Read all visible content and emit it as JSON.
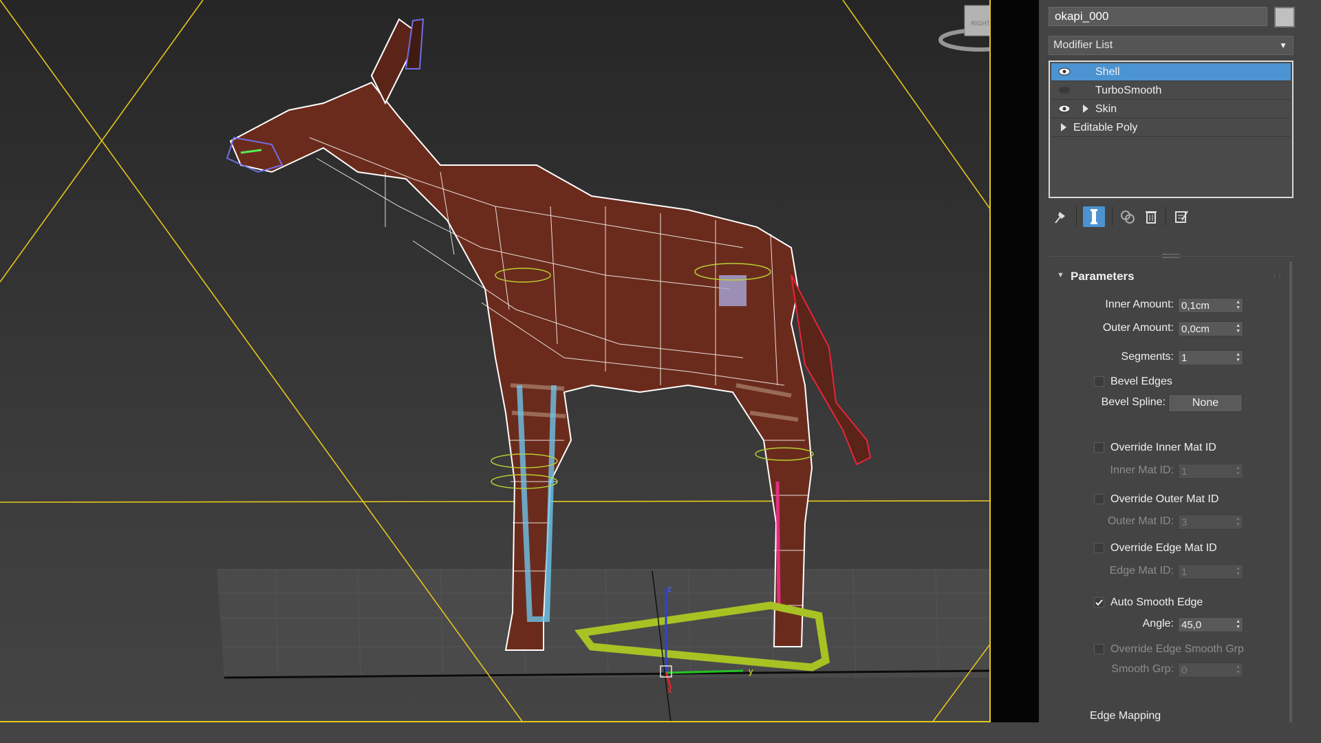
{
  "object_name": "okapi_000",
  "object_color": "#c0c0c0",
  "modifier_list_label": "Modifier List",
  "stack": [
    {
      "label": "Shell",
      "selected": true,
      "eye": "eye-icon"
    },
    {
      "label": "TurboSmooth",
      "selected": false,
      "eye": "eye-off-icon"
    },
    {
      "label": "Skin",
      "selected": false,
      "eye": "eye-icon"
    },
    {
      "label": "Editable Poly",
      "selected": false,
      "eye": ""
    }
  ],
  "toolbar_icons": [
    "pin-stack-icon",
    "show-end-result-icon",
    "make-unique-icon",
    "remove-modifier-icon",
    "configure-modifier-sets-icon"
  ],
  "rollout_title": "Parameters",
  "params": {
    "inner_amount_label": "Inner Amount:",
    "inner_amount": "0,1cm",
    "outer_amount_label": "Outer Amount:",
    "outer_amount": "0,0cm",
    "segments_label": "Segments:",
    "segments": "1",
    "bevel_edges_label": "Bevel Edges",
    "bevel_edges_checked": false,
    "bevel_spline_label": "Bevel Spline:",
    "bevel_spline_button": "None",
    "override_inner_mat_label": "Override Inner Mat ID",
    "inner_mat_label": "Inner Mat ID:",
    "inner_mat": "1",
    "override_outer_mat_label": "Override Outer Mat ID",
    "outer_mat_label": "Outer Mat ID:",
    "outer_mat": "3",
    "override_edge_mat_label": "Override Edge Mat ID",
    "edge_mat_label": "Edge Mat ID:",
    "edge_mat": "1",
    "auto_smooth_label": "Auto Smooth Edge",
    "auto_smooth_checked": true,
    "angle_label": "Angle:",
    "angle": "45,0",
    "override_smooth_grp_label": "Override Edge Smooth Grp",
    "smooth_grp_label": "Smooth Grp:",
    "smooth_grp": "0",
    "edge_mapping_label": "Edge Mapping"
  },
  "viewcube_label": "RIGHT",
  "gizmo_axes": {
    "z": "z",
    "y": "y",
    "x": "x"
  },
  "colors": {
    "accent": "#4b93d1",
    "safe_frame": "#e4c81a",
    "panel": "#444444"
  }
}
